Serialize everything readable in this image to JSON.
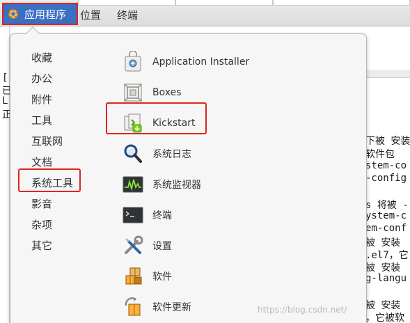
{
  "topbar": {
    "applications_label": "应用程序",
    "places_label": "位置",
    "terminal_label": "终端"
  },
  "menu": {
    "categories": [
      "收藏",
      "办公",
      "附件",
      "工具",
      "互联网",
      "文档",
      "系统工具",
      "影音",
      "杂项",
      "其它"
    ],
    "selected_category": "系统工具",
    "apps": [
      {
        "label": "Application Installer",
        "icon": "application-installer-icon"
      },
      {
        "label": "Boxes",
        "icon": "boxes-icon"
      },
      {
        "label": "Kickstart",
        "icon": "kickstart-icon"
      },
      {
        "label": "系统日志",
        "icon": "system-log-icon"
      },
      {
        "label": "系统监视器",
        "icon": "system-monitor-icon"
      },
      {
        "label": "终端",
        "icon": "terminal-icon"
      },
      {
        "label": "设置",
        "icon": "settings-icon"
      },
      {
        "label": "软件",
        "icon": "software-icon"
      },
      {
        "label": "软件更新",
        "icon": "software-update-icon"
      }
    ]
  },
  "background": {
    "left_chars": [
      "[",
      "已",
      "L",
      "正"
    ],
    "right_lines": [
      "下被 安装",
      "软件包",
      "stem-co",
      "-config",
      "s 将被 -",
      "ystem-c",
      "em-conf",
      "被 安装",
      ".el7，它",
      "被 安装",
      "g-langu",
      "被 安装",
      "，它被软"
    ]
  },
  "watermark": "https://blog.csdn.net/",
  "colors": {
    "highlight_red": "#e0251e",
    "app_button_blue": "#3a6fc4"
  }
}
